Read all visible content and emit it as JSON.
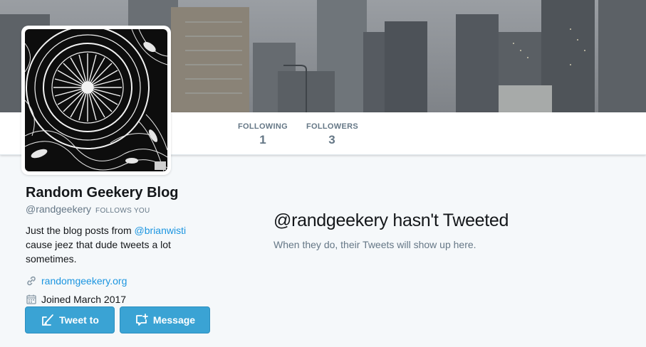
{
  "profile": {
    "display_name": "Random Geekery Blog",
    "handle": "@randgeekery",
    "follows_you": "FOLLOWS YOU",
    "bio_prefix": "Just the blog posts from ",
    "bio_mention": "@brianwisti",
    "bio_suffix": " cause jeez that dude tweets a lot sometimes.",
    "website": "randomgeekery.org",
    "joined": "Joined March 2017"
  },
  "stats": {
    "following_label": "FOLLOWING",
    "following_count": "1",
    "followers_label": "FOLLOWERS",
    "followers_count": "3"
  },
  "actions": {
    "tweet_label": "Tweet to",
    "message_label": "Message"
  },
  "timeline": {
    "empty_title": "@randgeekery hasn't Tweeted",
    "empty_subtitle": "When they do, their Tweets will show up here."
  },
  "icons": {
    "website": "link-icon",
    "joined": "calendar-icon",
    "tweet": "compose-icon",
    "message": "new-message-icon"
  },
  "colors": {
    "link": "#1b95e0",
    "button": "#3aa3d4",
    "muted": "#657786",
    "background": "#f5f8fa"
  }
}
